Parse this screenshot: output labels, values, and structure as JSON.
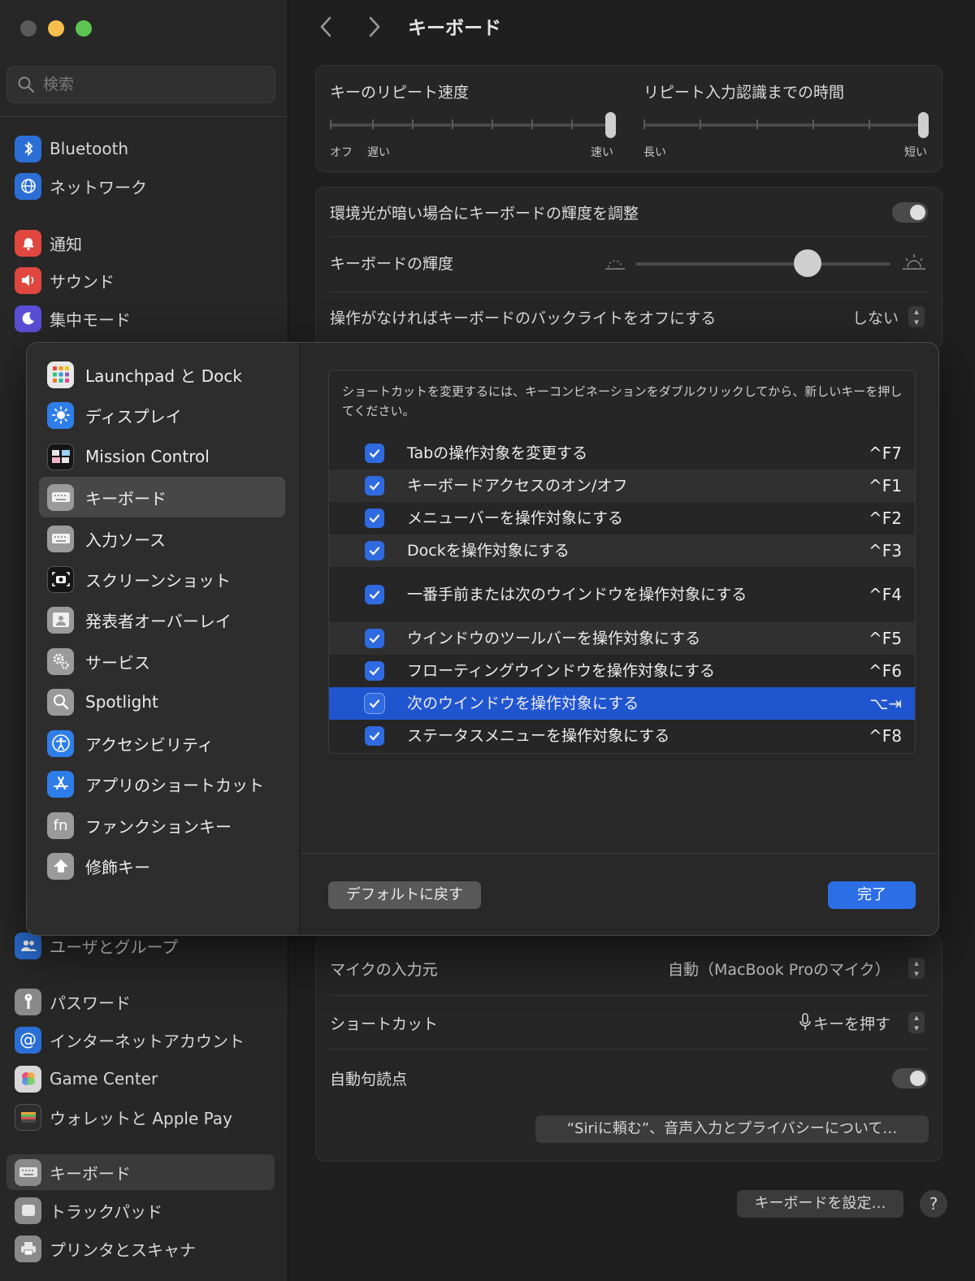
{
  "window": {
    "title": "キーボード"
  },
  "sidebar": {
    "search_placeholder": "検索",
    "items": [
      {
        "label": "Bluetooth",
        "icon": "bluetooth-icon",
        "color": "#2b6fd6"
      },
      {
        "label": "ネットワーク",
        "icon": "globe-icon",
        "color": "#2b6fd6"
      },
      {
        "label": "通知",
        "icon": "bell-icon",
        "color": "#e0473e"
      },
      {
        "label": "サウンド",
        "icon": "speaker-icon",
        "color": "#e0473e"
      },
      {
        "label": "集中モード",
        "icon": "moon-icon",
        "color": "#5a4fd6"
      },
      {
        "label": "ユーザとグループ",
        "icon": "users-icon",
        "color": "#2b6fd6"
      },
      {
        "label": "パスワード",
        "icon": "key-icon",
        "color": "#8a8a8a"
      },
      {
        "label": "インターネットアカウント",
        "icon": "at-icon",
        "color": "#2b6fd6"
      },
      {
        "label": "Game Center",
        "icon": "game-center-icon",
        "color": "#cfcfcf"
      },
      {
        "label": "ウォレットと Apple Pay",
        "icon": "wallet-icon",
        "color": "#3a3a3a"
      },
      {
        "label": "キーボード",
        "icon": "keyboard-icon",
        "color": "#8a8a8a",
        "active": true
      },
      {
        "label": "トラックパッド",
        "icon": "trackpad-icon",
        "color": "#8a8a8a"
      },
      {
        "label": "プリンタとスキャナ",
        "icon": "printer-icon",
        "color": "#8a8a8a"
      }
    ]
  },
  "main": {
    "repeat_rate_label": "キーのリピート速度",
    "repeat_rate_left": "オフ",
    "repeat_rate_slow": "遅い",
    "repeat_rate_fast": "速い",
    "delay_label": "リピート入力認識までの時間",
    "delay_long": "長い",
    "delay_short": "短い",
    "ambient_label": "環境光が暗い場合にキーボードの輝度を調整",
    "brightness_label": "キーボードの輝度",
    "backlight_off_label": "操作がなければキーボードのバックライトをオフにする",
    "backlight_off_value": "しない",
    "mic_label": "マイクの入力元",
    "mic_value": "自動（MacBook Proのマイク）",
    "shortcut_label": "ショートカット",
    "shortcut_value": "キーを押す",
    "auto_punct_label": "自動句読点",
    "siri_button": "“Siriに頼む”、音声入力とプライバシーについて…",
    "setup_keyboard_button": "キーボードを設定…",
    "help_button": "?"
  },
  "modal": {
    "categories": [
      {
        "label": "Launchpad と Dock",
        "icon": "launchpad-icon",
        "color": "#e8e8e8"
      },
      {
        "label": "ディスプレイ",
        "icon": "display-icon",
        "color": "#2f7de8"
      },
      {
        "label": "Mission Control",
        "icon": "mission-control-icon",
        "color": "#1a1a1a"
      },
      {
        "label": "キーボード",
        "icon": "keyboard-icon",
        "color": "#9a9a9a",
        "active": true
      },
      {
        "label": "入力ソース",
        "icon": "keyboard-icon",
        "color": "#9a9a9a"
      },
      {
        "label": "スクリーンショット",
        "icon": "camera-icon",
        "color": "#1a1a1a"
      },
      {
        "label": "発表者オーバーレイ",
        "icon": "presenter-icon",
        "color": "#9a9a9a"
      },
      {
        "label": "サービス",
        "icon": "gears-icon",
        "color": "#9a9a9a"
      },
      {
        "label": "Spotlight",
        "icon": "magnifier-icon",
        "color": "#9a9a9a"
      },
      {
        "label": "アクセシビリティ",
        "icon": "accessibility-icon",
        "color": "#2f7de8"
      },
      {
        "label": "アプリのショートカット",
        "icon": "app-store-icon",
        "color": "#2f7de8"
      },
      {
        "label": "ファンクションキー",
        "icon": "fn-icon",
        "color": "#9a9a9a"
      },
      {
        "label": "修飾キー",
        "icon": "arrow-up-icon",
        "color": "#9a9a9a"
      }
    ],
    "description": "ショートカットを変更するには、キーコンビネーションをダブルクリックしてから、新しいキーを押してください。",
    "shortcuts": [
      {
        "name": "Tabの操作対象を変更する",
        "key": "^F7",
        "checked": true
      },
      {
        "name": "キーボードアクセスのオン/オフ",
        "key": "^F1",
        "checked": true
      },
      {
        "name": "メニューバーを操作対象にする",
        "key": "^F2",
        "checked": true
      },
      {
        "name": "Dockを操作対象にする",
        "key": "^F3",
        "checked": true
      },
      {
        "name": "一番手前または次のウインドウを操作対象にする",
        "key": "^F4",
        "checked": true
      },
      {
        "name": "ウインドウのツールバーを操作対象にする",
        "key": "^F5",
        "checked": true
      },
      {
        "name": "フローティングウインドウを操作対象にする",
        "key": "^F6",
        "checked": true
      },
      {
        "name": "次のウインドウを操作対象にする",
        "key": "⌥⇥",
        "checked": true,
        "selected": true
      },
      {
        "name": "ステータスメニューを操作対象にする",
        "key": "^F8",
        "checked": true
      }
    ],
    "restore_default_button": "デフォルトに戻す",
    "done_button": "完了"
  }
}
